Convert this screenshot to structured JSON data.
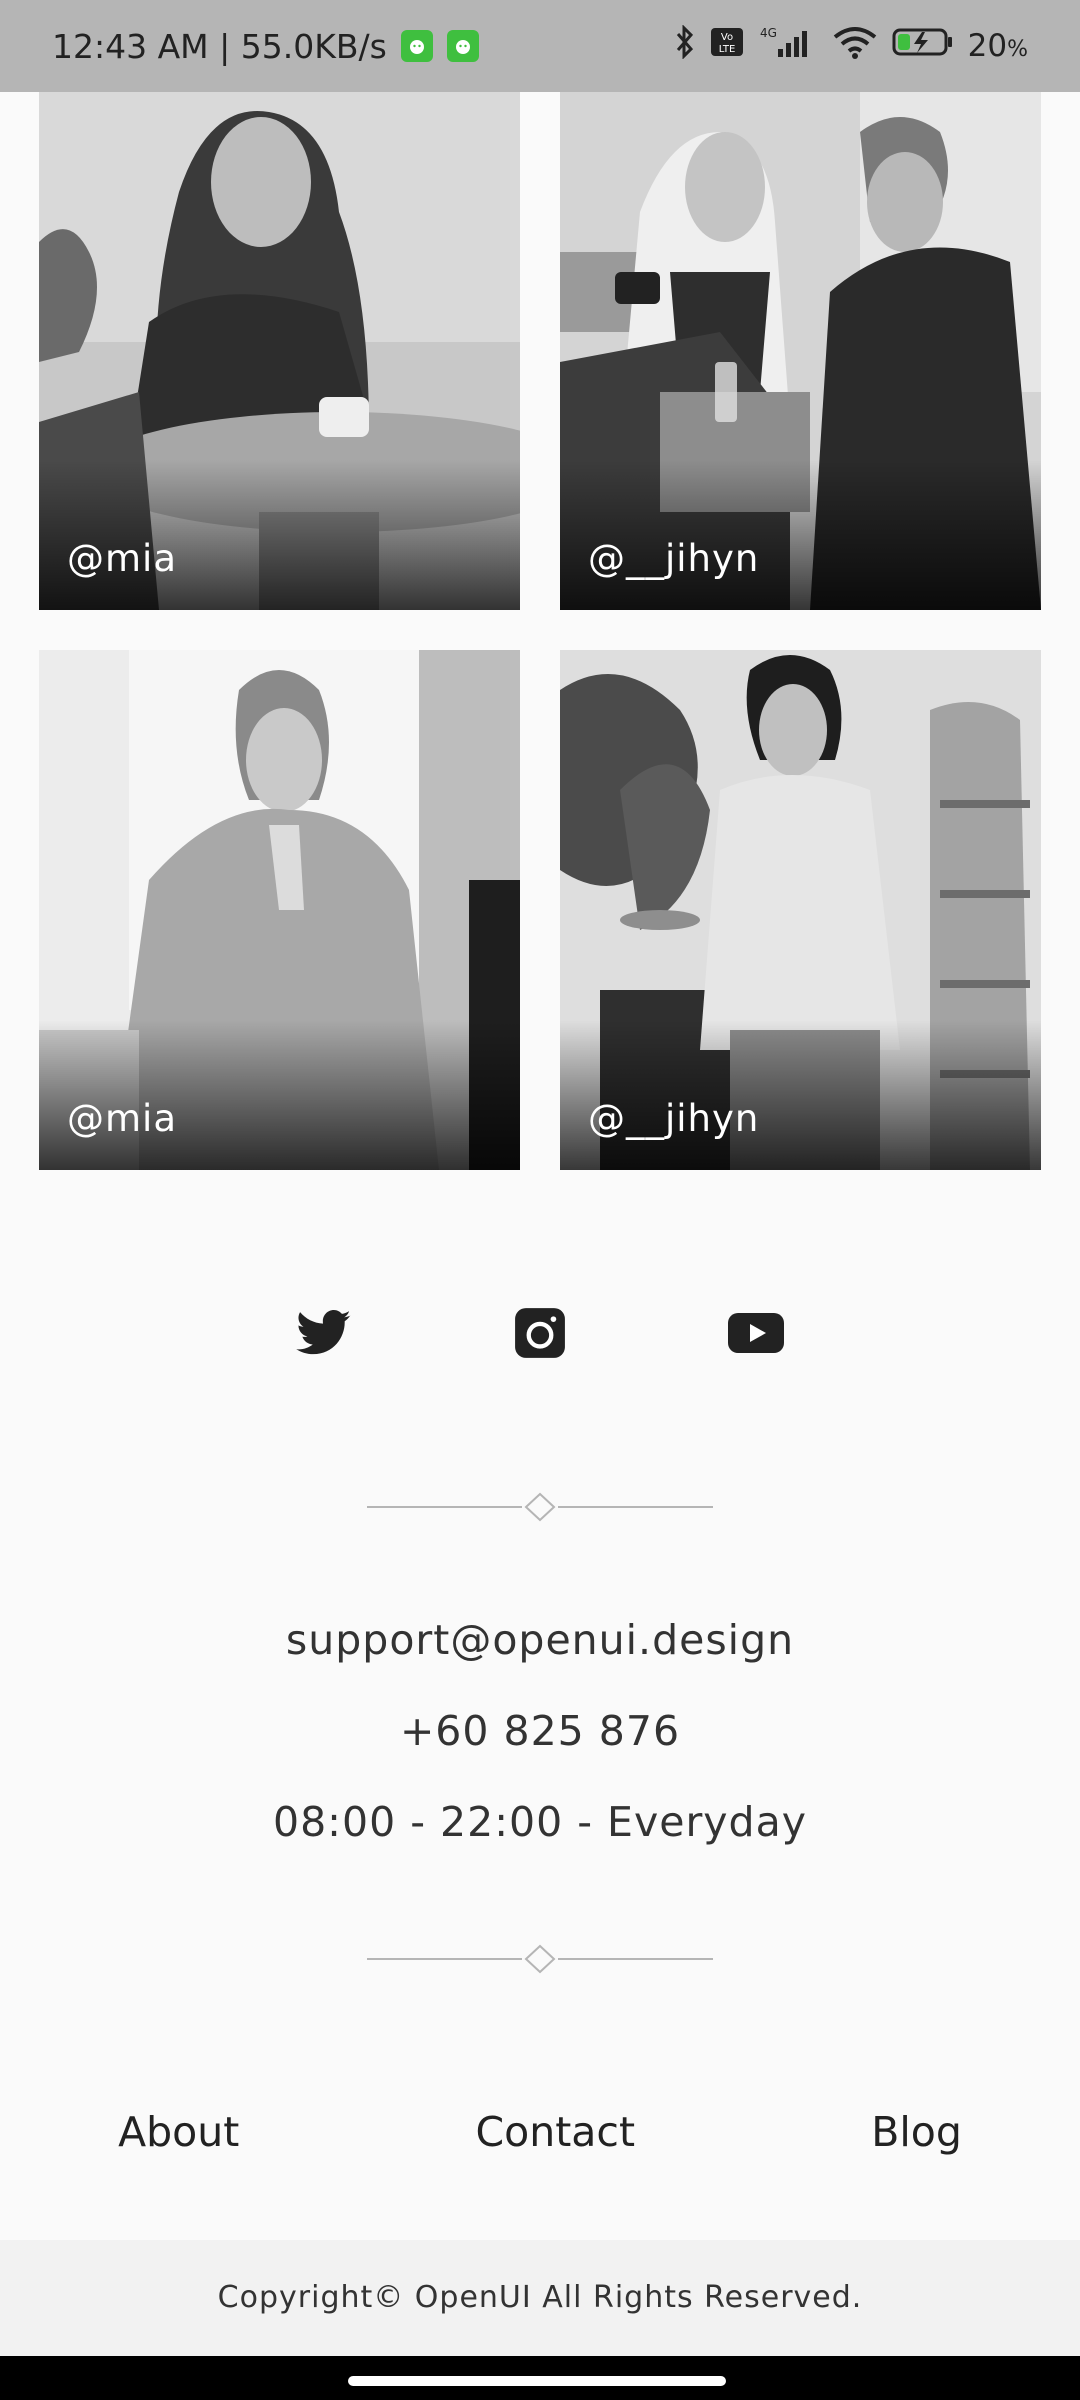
{
  "status_bar": {
    "time_speed": "12:43 AM | 55.0KB/s",
    "battery": "20",
    "battery_unit": "%",
    "network": "4G"
  },
  "photos": [
    {
      "handle": "@mia"
    },
    {
      "handle": "@__jihyn"
    },
    {
      "handle": "@mia"
    },
    {
      "handle": "@__jihyn"
    }
  ],
  "social": [
    "twitter-icon",
    "instagram-icon",
    "youtube-icon"
  ],
  "contact": {
    "email": "support@openui.design",
    "phone": "+60 825 876",
    "hours": "08:00 - 22:00 - Everyday"
  },
  "footer": {
    "links": [
      "About",
      "Contact",
      "Blog"
    ],
    "copyright": "Copyright© OpenUI All Rights Reserved."
  },
  "colors": {
    "status_bar": "#b5b5b5",
    "background": "#fafafa",
    "divider": "#b5b5b5"
  }
}
